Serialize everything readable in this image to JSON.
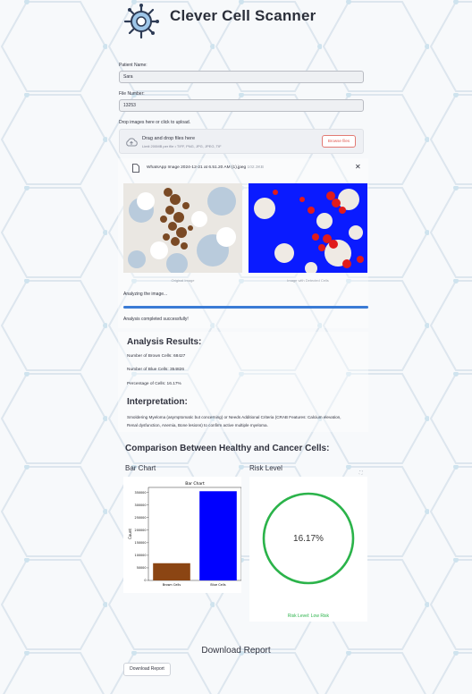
{
  "app": {
    "title": "Clever Cell Scanner"
  },
  "form": {
    "patient_name_label": "Patient Name:",
    "patient_name_value": "Sara",
    "file_number_label": "File Number:",
    "file_number_value": "13253"
  },
  "uploader": {
    "label": "Drop images here or click to upload.",
    "title": "Drag and drop files here",
    "subtitle": "Limit 200MB per file • TIFF, PNG, JPG, JPEG, TIF",
    "browse_label": "Browse files",
    "file_name": "WhatsApp Image 2024-12-21 at 6.51.20 AM (1).jpeg",
    "file_size": "102.3KB",
    "close_glyph": "✕"
  },
  "images": {
    "original_caption": "Original Image",
    "detected_caption": "Image with Detected Cells"
  },
  "progress": {
    "label": "Analyzing the image...",
    "percent": 100,
    "done_message": "Analysis completed successfully!"
  },
  "results": {
    "heading": "Analysis Results:",
    "brown_line": "Number of Brown Cells: 68427",
    "blue_line": "Number of Blue Cells: 354826",
    "percentage_line": "Percentage of Cells: 16.17%"
  },
  "interpretation": {
    "heading": "Interpretation:",
    "text": "Smoldering Myeloma (asymptomatic but concerning) or Needs Additional Criteria (CRAB Features: Calcium elevation, Renal dysfunction, Anemia, Bone lesions) to confirm active multiple myeloma."
  },
  "comparison": {
    "heading": "Comparison Between Healthy and Cancer Cells:",
    "bar_heading": "Bar Chart",
    "risk_heading": "Risk Level"
  },
  "chart_data": {
    "type": "bar",
    "title": "Bar Chart",
    "categories": [
      "Brown Cells",
      "Blue Cells"
    ],
    "values": [
      68427,
      354826
    ],
    "colors": [
      "#8b4513",
      "#0000ff"
    ],
    "xlabel": "",
    "ylabel": "Count",
    "ylim": [
      0,
      370000
    ],
    "yticks": [
      0,
      50000,
      100000,
      150000,
      200000,
      250000,
      300000,
      350000
    ]
  },
  "risk": {
    "value_label": "16.17%",
    "level_label": "Risk Level: Low Risk",
    "ring_color": "#2bb34a",
    "expand_glyph": "⛶"
  },
  "download": {
    "heading": "Download Report",
    "button_label": "Download Report"
  }
}
